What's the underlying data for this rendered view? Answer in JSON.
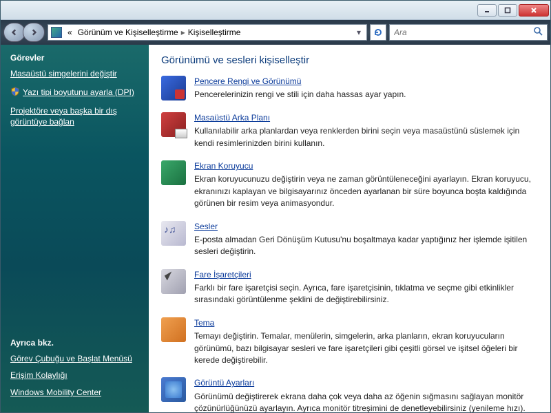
{
  "titlebar": {
    "min": "_",
    "max": "▭",
    "close": "✕"
  },
  "nav": {
    "crumb_prefix": "«",
    "crumb1": "Görünüm ve Kişiselleştirme",
    "crumb2": "Kişiselleştirme",
    "search_placeholder": "Ara"
  },
  "sidebar": {
    "tasks_header": "Görevler",
    "task1": "Masaüstü simgelerini değiştir",
    "task2": "Yazı tipi boyutunu ayarla (DPI)",
    "task3": "Projektöre veya başka bir dış görüntüye bağlan",
    "see_also_header": "Ayrıca bkz.",
    "see1": "Görev Çubuğu ve Başlat Menüsü",
    "see2": "Erişim Kolaylığı",
    "see3": "Windows Mobility Center"
  },
  "main": {
    "heading": "Görünümü ve sesleri kişiselleştir",
    "items": [
      {
        "title": "Pencere Rengi ve Görünümü",
        "desc": "Pencerelerinizin rengi ve stili için daha hassas ayar yapın."
      },
      {
        "title": "Masaüstü Arka Planı",
        "desc": "Kullanılabilir arka planlardan veya renklerden birini seçin veya masaüstünü süslemek için kendi resimlerinizden birini kullanın."
      },
      {
        "title": "Ekran Koruyucu",
        "desc": "Ekran koruyucunuzu değiştirin veya ne zaman görüntüleneceğini ayarlayın. Ekran koruyucu, ekranınızı kaplayan ve bilgisayarınız önceden ayarlanan bir süre boyunca boşta kaldığında görünen bir resim veya animasyondur."
      },
      {
        "title": "Sesler",
        "desc": "E-posta almadan Geri Dönüşüm Kutusu'nu boşaltmaya kadar yaptığınız her işlemde işitilen sesleri değiştirin."
      },
      {
        "title": "Fare İşaretçileri",
        "desc": "Farklı bir fare işaretçisi seçin. Ayrıca, fare işaretçisinin, tıklatma ve seçme gibi etkinlikler sırasındaki görüntülenme şeklini de değiştirebilirsiniz."
      },
      {
        "title": "Tema",
        "desc": "Temayı değiştirin. Temalar, menülerin, simgelerin, arka planların, ekran koruyucuların görünümü, bazı bilgisayar sesleri ve fare işaretçileri gibi çeşitli görsel ve işitsel öğeleri bir kerede değiştirebilir."
      },
      {
        "title": "Görüntü Ayarları",
        "desc": "Görünümü değiştirerek ekrana daha çok veya daha az öğenin sığmasını sağlayan monitör çözünürlüğünüzü ayarlayın. Ayrıca monitör titreşimini de denetleyebilirsiniz (yenileme hızı)."
      }
    ]
  }
}
